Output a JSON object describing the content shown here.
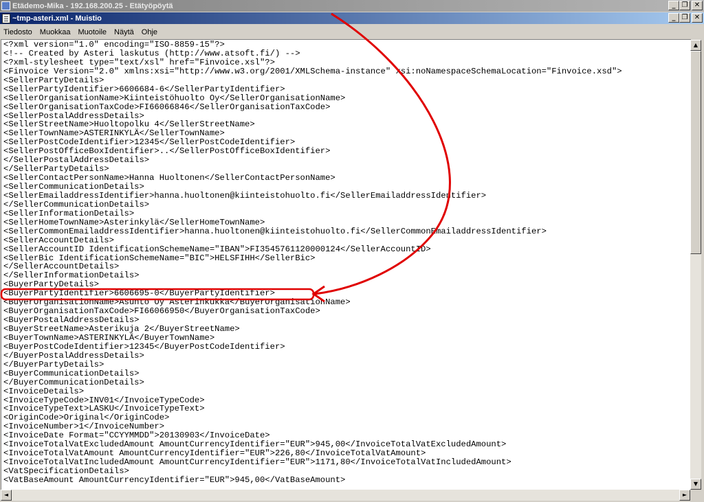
{
  "remote_window": {
    "title": "Etädemo-Mika - 192.168.200.25 - Etätyöpöytä"
  },
  "notepad_window": {
    "title": "~tmp-asteri.xml - Muistio"
  },
  "window_buttons": {
    "minimize": "_",
    "maximize": "❐",
    "close": "✕"
  },
  "menu": [
    "Tiedosto",
    "Muokkaa",
    "Muotoile",
    "Näytä",
    "Ohje"
  ],
  "scroll_glyphs": {
    "up": "▲",
    "down": "▼",
    "left": "◄",
    "right": "►"
  },
  "document_lines": [
    "<?xml version=\"1.0\" encoding=\"ISO-8859-15\"?>",
    "<!-- Created by Asteri laskutus (http://www.atsoft.fi/) -->",
    "<?xml-stylesheet type=\"text/xsl\" href=\"Finvoice.xsl\"?>",
    "<Finvoice Version=\"2.0\" xmlns:xsi=\"http://www.w3.org/2001/XMLSchema-instance\" xsi:noNamespaceSchemaLocation=\"Finvoice.xsd\">",
    "<SellerPartyDetails>",
    "<SellerPartyIdentifier>6606684-6</SellerPartyIdentifier>",
    "<SellerOrganisationName>Kiinteistöhuolto Oy</SellerOrganisationName>",
    "<SellerOrganisationTaxCode>FI66066846</SellerOrganisationTaxCode>",
    "<SellerPostalAddressDetails>",
    "<SellerStreetName>Huoltopolku 4</SellerStreetName>",
    "<SellerTownName>ASTERINKYLÄ</SellerTownName>",
    "<SellerPostCodeIdentifier>12345</SellerPostCodeIdentifier>",
    "<SellerPostOfficeBoxIdentifier>..</SellerPostOfficeBoxIdentifier>",
    "</SellerPostalAddressDetails>",
    "</SellerPartyDetails>",
    "<SellerContactPersonName>Hanna Huoltonen</SellerContactPersonName>",
    "<SellerCommunicationDetails>",
    "<SellerEmailaddressIdentifier>hanna.huoltonen@kiinteistohuolto.fi</SellerEmailaddressIdentifier>",
    "</SellerCommunicationDetails>",
    "<SellerInformationDetails>",
    "<SellerHomeTownName>Asterinkylä</SellerHomeTownName>",
    "<SellerCommonEmailaddressIdentifier>hanna.huoltonen@kiinteistohuolto.fi</SellerCommonEmailaddressIdentifier>",
    "<SellerAccountDetails>",
    "<SellerAccountID IdentificationSchemeName=\"IBAN\">FI3545761120000124</SellerAccountID>",
    "<SellerBic IdentificationSchemeName=\"BIC\">HELSFIHH</SellerBic>",
    "</SellerAccountDetails>",
    "</SellerInformationDetails>",
    "<BuyerPartyDetails>",
    "<BuyerPartyIdentifier>6606695-0</BuyerPartyIdentifier>",
    "<BuyerOrganisationName>Asunto Oy Asterinkukka</BuyerOrganisationName>",
    "<BuyerOrganisationTaxCode>FI66066950</BuyerOrganisationTaxCode>",
    "<BuyerPostalAddressDetails>",
    "<BuyerStreetName>Asterikuja 2</BuyerStreetName>",
    "<BuyerTownName>ASTERINKYLÄ</BuyerTownName>",
    "<BuyerPostCodeIdentifier>12345</BuyerPostCodeIdentifier>",
    "</BuyerPostalAddressDetails>",
    "</BuyerPartyDetails>",
    "<BuyerCommunicationDetails>",
    "</BuyerCommunicationDetails>",
    "<InvoiceDetails>",
    "<InvoiceTypeCode>INV01</InvoiceTypeCode>",
    "<InvoiceTypeText>LASKU</InvoiceTypeText>",
    "<OriginCode>Original</OriginCode>",
    "<InvoiceNumber>1</InvoiceNumber>",
    "<InvoiceDate Format=\"CCYYMMDD\">20130903</InvoiceDate>",
    "<InvoiceTotalVatExcludedAmount AmountCurrencyIdentifier=\"EUR\">945,00</InvoiceTotalVatExcludedAmount>",
    "<InvoiceTotalVatAmount AmountCurrencyIdentifier=\"EUR\">226,80</InvoiceTotalVatAmount>",
    "<InvoiceTotalVatIncludedAmount AmountCurrencyIdentifier=\"EUR\">1171,80</InvoiceTotalVatIncludedAmount>",
    "<VatSpecificationDetails>",
    "<VatBaseAmount AmountCurrencyIdentifier=\"EUR\">945,00</VatBaseAmount>"
  ],
  "annotation": {
    "color": "#e00000",
    "highlighted_line": 28
  }
}
